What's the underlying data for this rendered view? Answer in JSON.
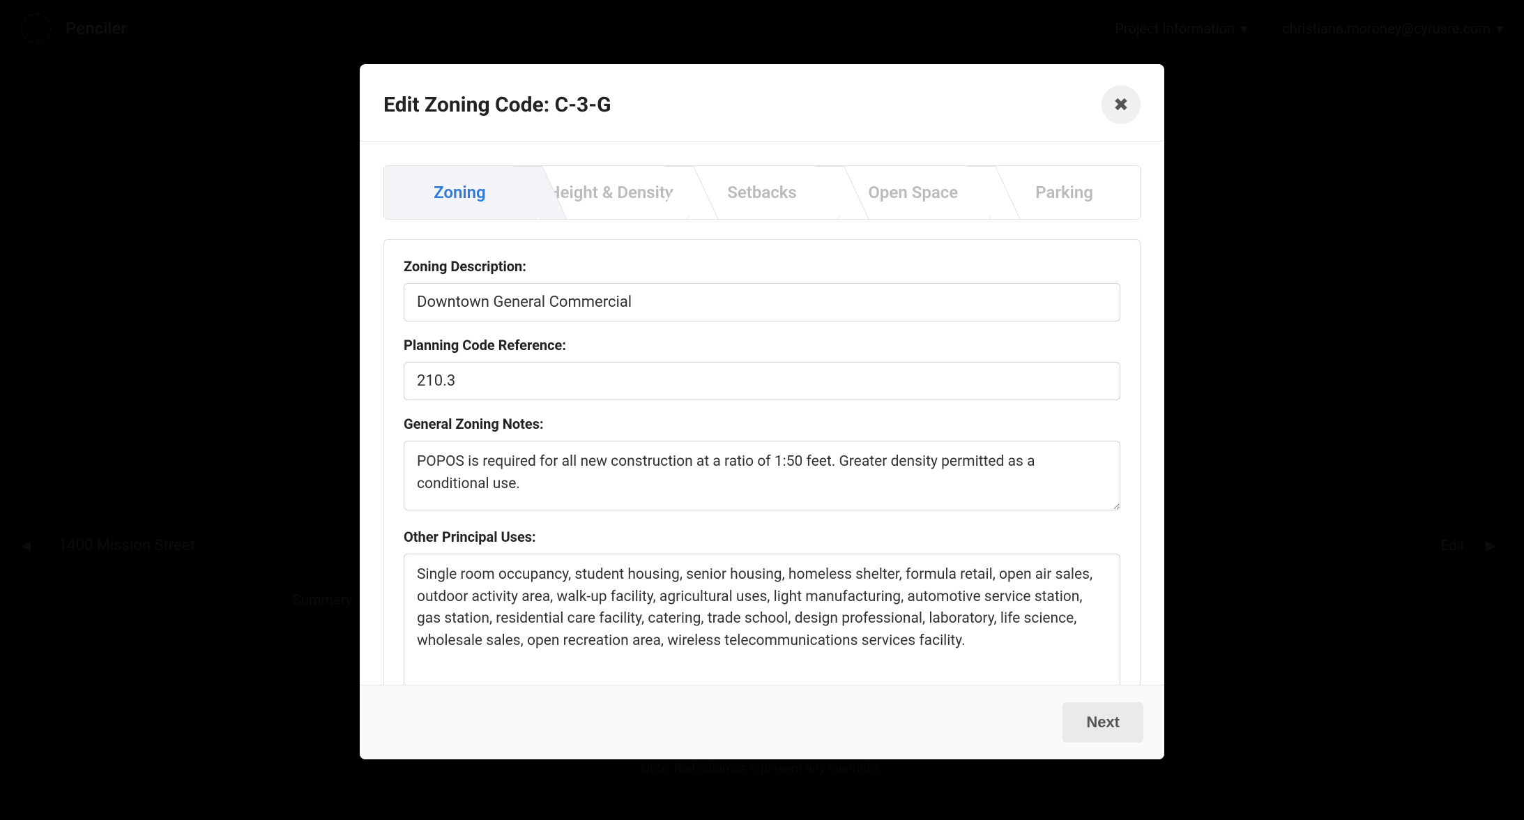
{
  "background": {
    "brand": "Penciler",
    "project_info": "Project Information",
    "user": "christiana.moroney@cyrusre.com",
    "address": "1400 Mission Street",
    "summary_label": "Summary",
    "edit_label": "Edit",
    "footnote": "Note: Red columns represent any overrides."
  },
  "modal": {
    "title": "Edit Zoning Code: C-3-G",
    "tabs": [
      "Zoning",
      "Height & Density",
      "Setbacks",
      "Open Space",
      "Parking"
    ],
    "fields": {
      "zoning_description": {
        "label": "Zoning Description:",
        "value": "Downtown General Commercial"
      },
      "planning_code_reference": {
        "label": "Planning Code Reference:",
        "value": "210.3"
      },
      "general_zoning_notes": {
        "label": "General Zoning Notes:",
        "value": "POPOS is required for all new construction at a ratio of 1:50 feet. Greater density permitted as a conditional use."
      },
      "other_principal_uses": {
        "label": "Other Principal Uses:",
        "value": "Single room occupancy, student housing, senior housing, homeless shelter, formula retail, open air sales, outdoor activity area, walk-up facility, agricultural uses, light manufacturing, automotive service station, gas station, residential care facility, catering, trade school, design professional, laboratory, life science, wholesale sales, open recreation area, wireless telecommunications services facility."
      }
    },
    "next_button": "Next"
  }
}
